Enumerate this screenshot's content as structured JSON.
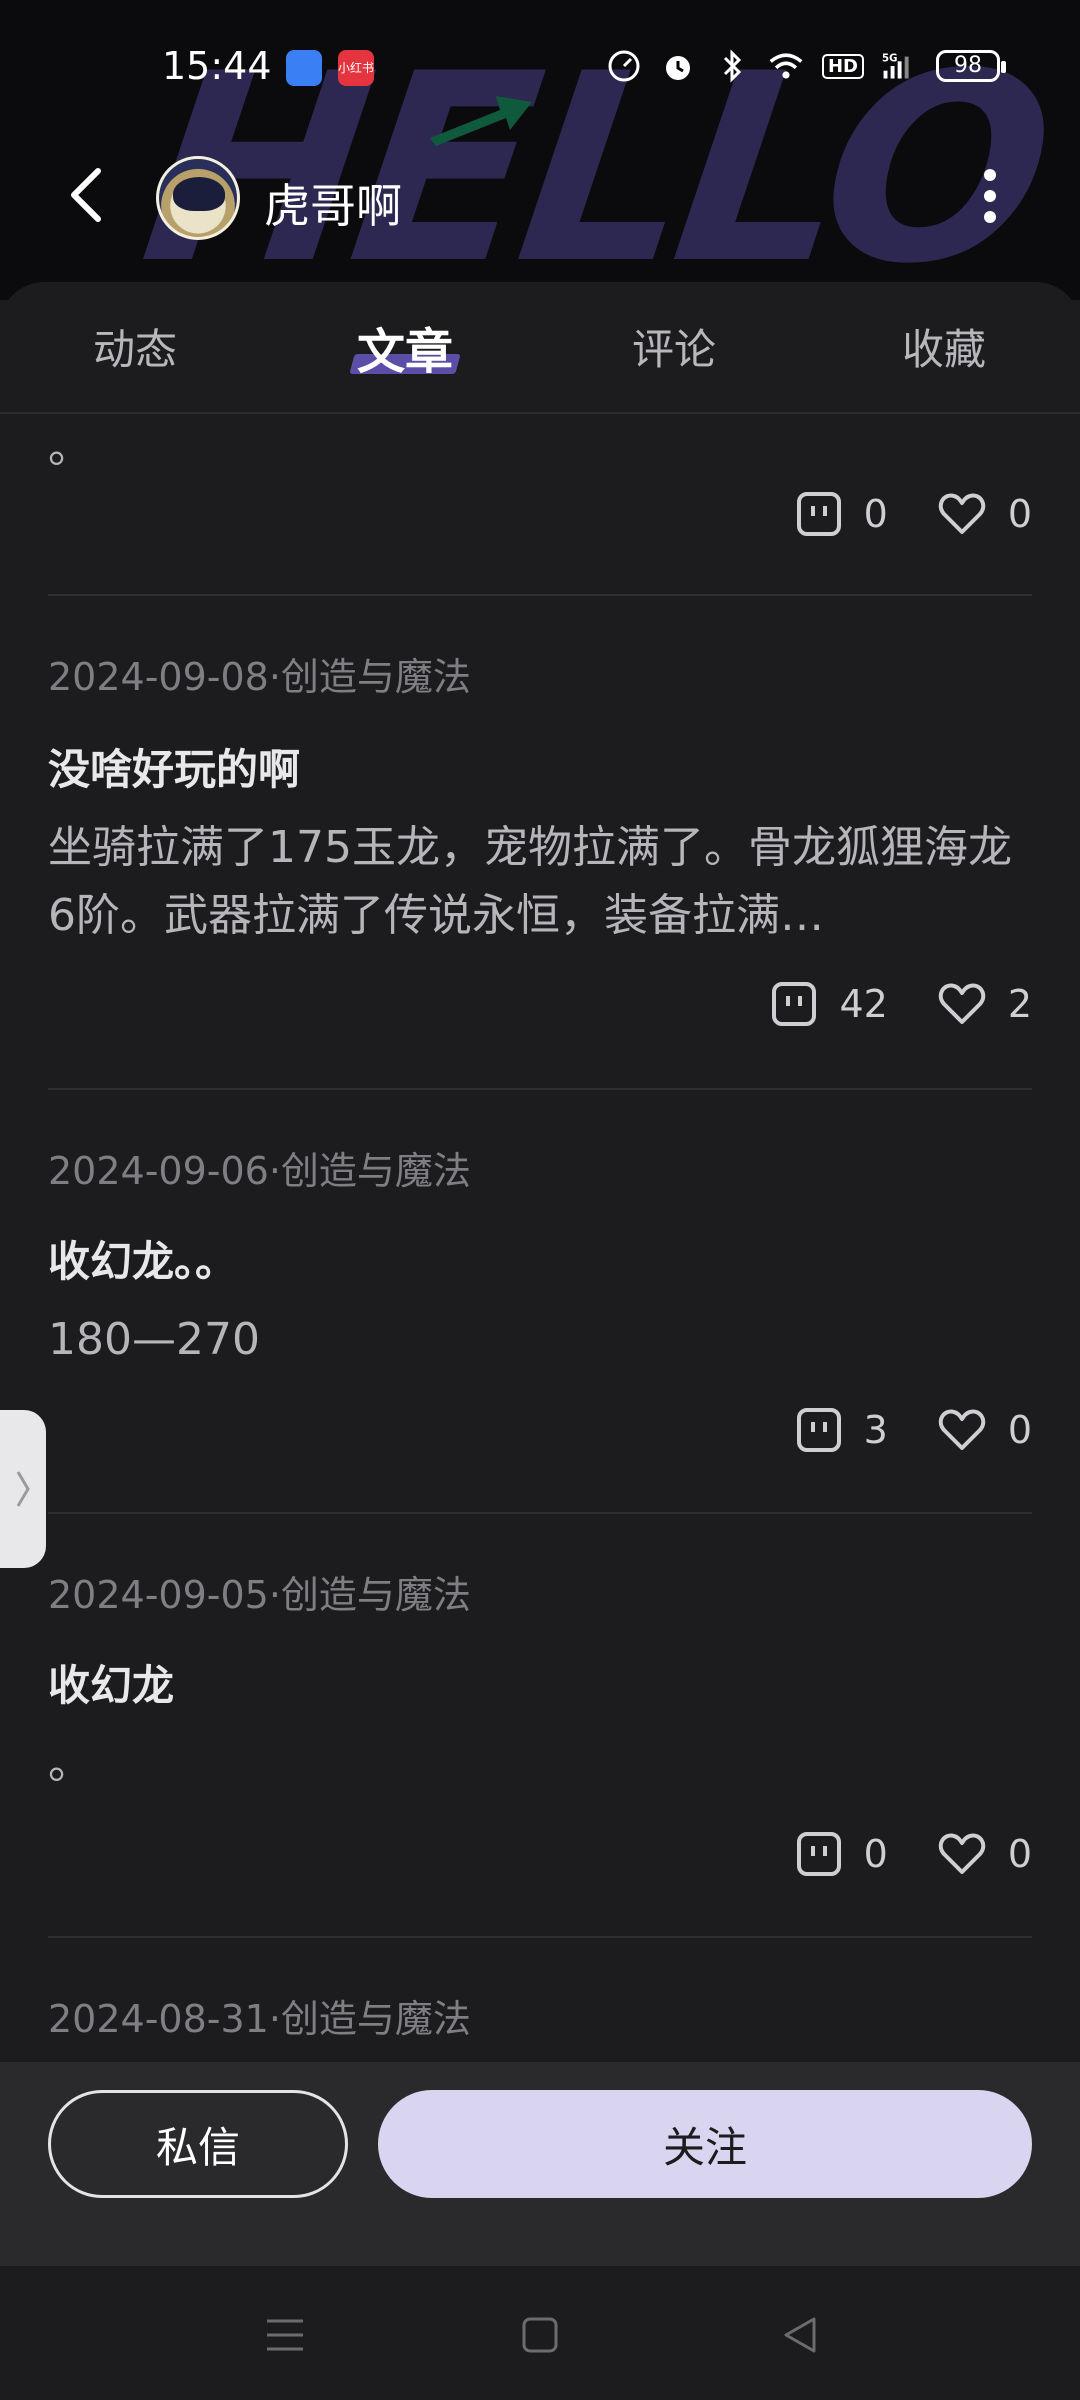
{
  "status_bar": {
    "time": "15:44",
    "app_badge": "小红书",
    "hd_label": "HD",
    "network": "5G",
    "battery": "98"
  },
  "header": {
    "background_text": "HELLO",
    "user_name": "虎哥啊"
  },
  "tabs": [
    {
      "label": "动态",
      "active": false
    },
    {
      "label": "文章",
      "active": true
    },
    {
      "label": "评论",
      "active": false
    },
    {
      "label": "收藏",
      "active": false
    }
  ],
  "articles": [
    {
      "body": "。",
      "comments": "0",
      "likes": "0"
    },
    {
      "meta": "2024-09-08·创造与魔法",
      "title": "没啥好玩的啊",
      "body": "坐骑拉满了175玉龙，宠物拉满了。骨龙狐狸海龙6阶。武器拉满了传说永恒，装备拉满…",
      "comments": "42",
      "likes": "2"
    },
    {
      "meta": "2024-09-06·创造与魔法",
      "title": "收幻龙。。",
      "body": "180—270",
      "comments": "3",
      "likes": "0"
    },
    {
      "meta": "2024-09-05·创造与魔法",
      "title": "收幻龙",
      "body": "。",
      "comments": "0",
      "likes": "0"
    },
    {
      "meta": "2024-08-31·创造与魔法"
    }
  ],
  "bottom_bar": {
    "dm_label": "私信",
    "follow_label": "关注"
  },
  "colors": {
    "accent": "#5b4ea6",
    "follow_bg": "#d9d4ef",
    "background": "#1c1c1e"
  }
}
